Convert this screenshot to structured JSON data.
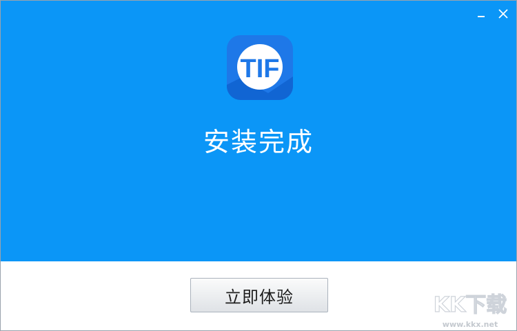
{
  "window": {
    "minimize_icon": "minimize-icon",
    "close_icon": "close-icon"
  },
  "header": {
    "background_color": "#0b96f7",
    "app_icon_text": "TIF",
    "title": "安装完成"
  },
  "footer": {
    "primary_button_label": "立即体验"
  },
  "watermark": {
    "brand": "KK下载",
    "url": "www.kkx.net"
  }
}
